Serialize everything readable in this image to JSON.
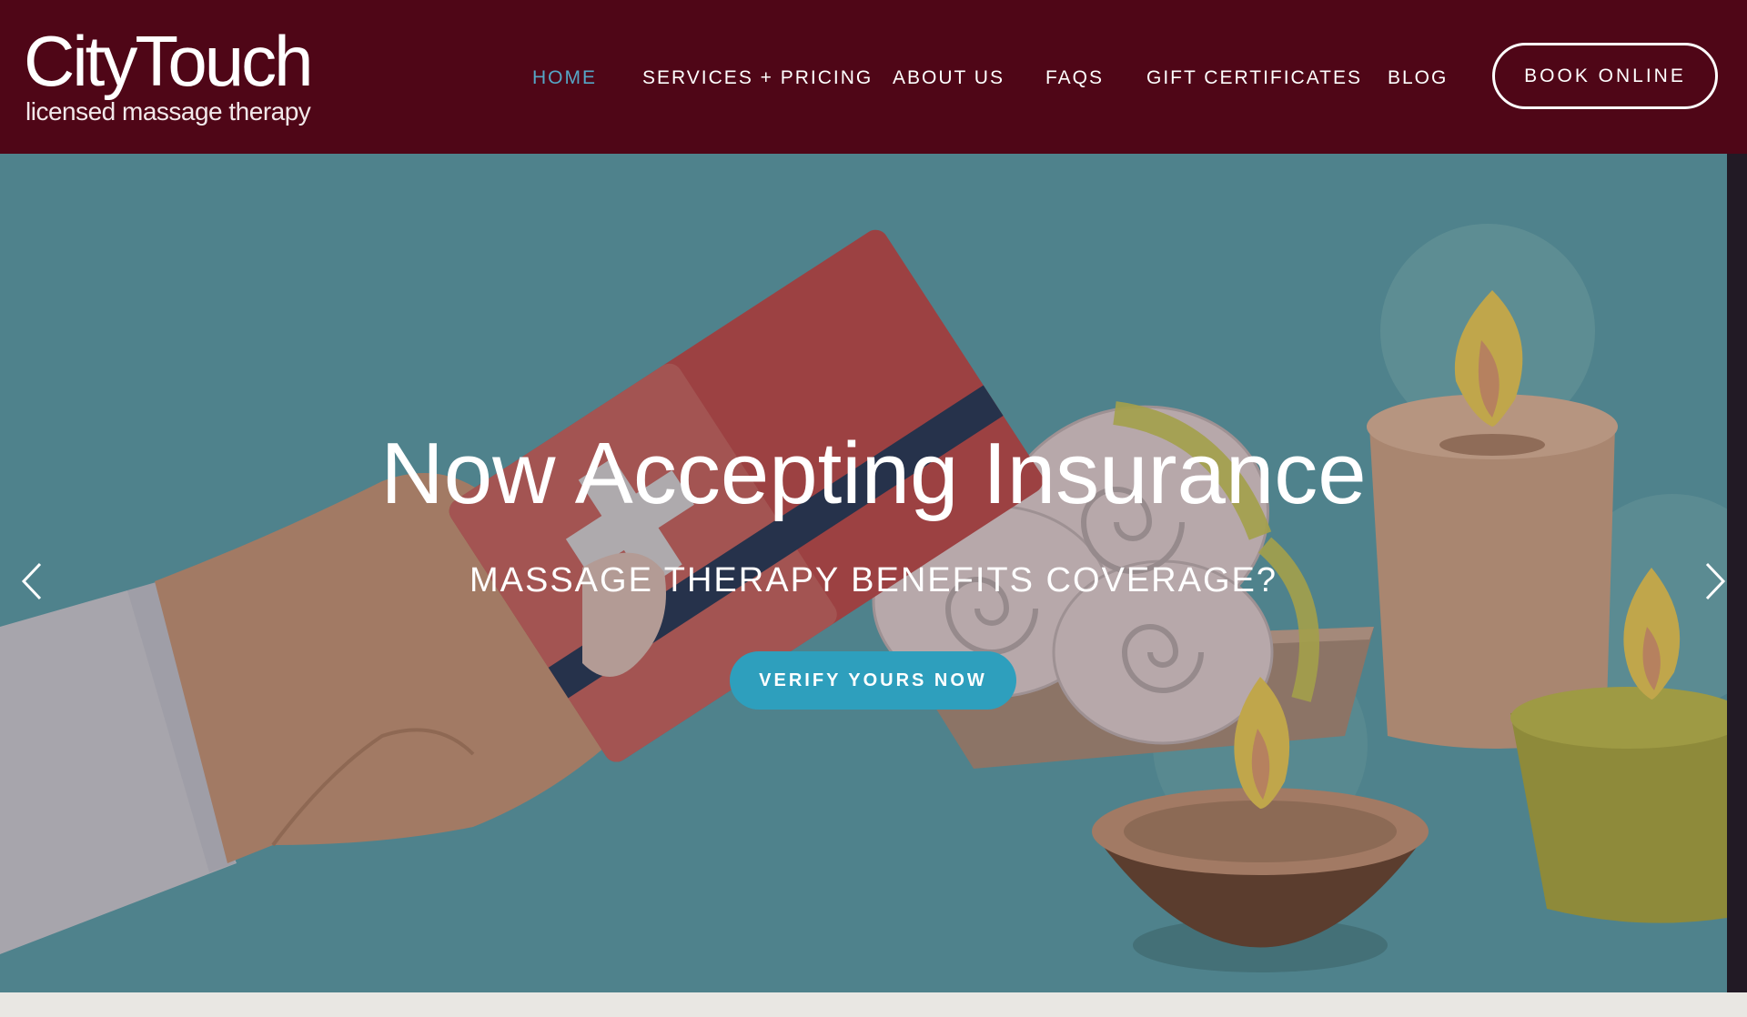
{
  "brand": {
    "name": "CityTouch",
    "tagline": "licensed massage therapy"
  },
  "nav": {
    "items": [
      {
        "label": "HOME",
        "active": true
      },
      {
        "label": "SERVICES + PRICING",
        "active": false
      },
      {
        "label": "ABOUT US",
        "active": false
      },
      {
        "label": "FAQS",
        "active": false
      },
      {
        "label": "GIFT CERTIFICATES",
        "active": false
      },
      {
        "label": "BLOG",
        "active": false
      }
    ],
    "cta_label": "BOOK ONLINE"
  },
  "hero": {
    "title": "Now Accepting Insurance",
    "subtitle": "MASSAGE THERAPY BENEFITS COVERAGE?",
    "button_label": "VERIFY YOURS NOW",
    "prev_icon": "chevron-left-icon",
    "next_icon": "chevron-right-icon"
  },
  "colors": {
    "header_bg": "#4f0617",
    "nav_active": "#55a6c6",
    "hero_bg": "#4f828c",
    "button_bg": "#2e9fbd",
    "footer_strip": "#e9e7e3"
  }
}
